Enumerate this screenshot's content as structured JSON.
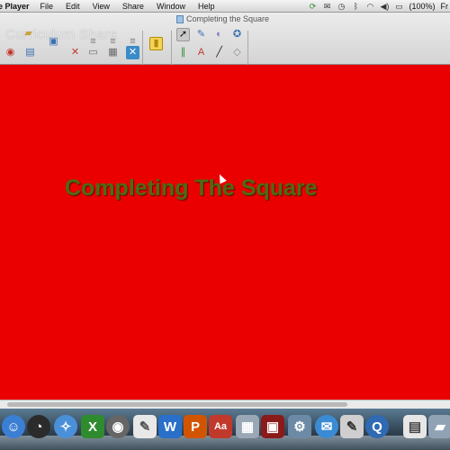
{
  "menubar": {
    "app_name": "e Player",
    "items": [
      "File",
      "Edit",
      "View",
      "Share",
      "Window",
      "Help"
    ],
    "battery_label": "(100%)",
    "clock_partial": "Fr"
  },
  "window": {
    "title": "Completing the Square",
    "watermark": "Curriculum Share"
  },
  "board": {
    "background_color": "#ea0000",
    "title": "Completing The Square"
  },
  "icons": {
    "status": [
      "sync-icon",
      "mail-icon",
      "clock-icon",
      "bluetooth-icon",
      "wifi-icon",
      "volume-icon",
      "battery-icon"
    ],
    "dock": [
      "finder-icon",
      "dashboard-icon",
      "safari-icon",
      "excel-icon",
      "camera-icon",
      "notes-icon",
      "word-icon",
      "powerpoint-icon",
      "dictionary-icon",
      "preview-icon",
      "photo-booth-icon",
      "app-store-icon",
      "mail-icon",
      "quicktime-icon",
      "document-icon",
      "folder-icon"
    ]
  }
}
